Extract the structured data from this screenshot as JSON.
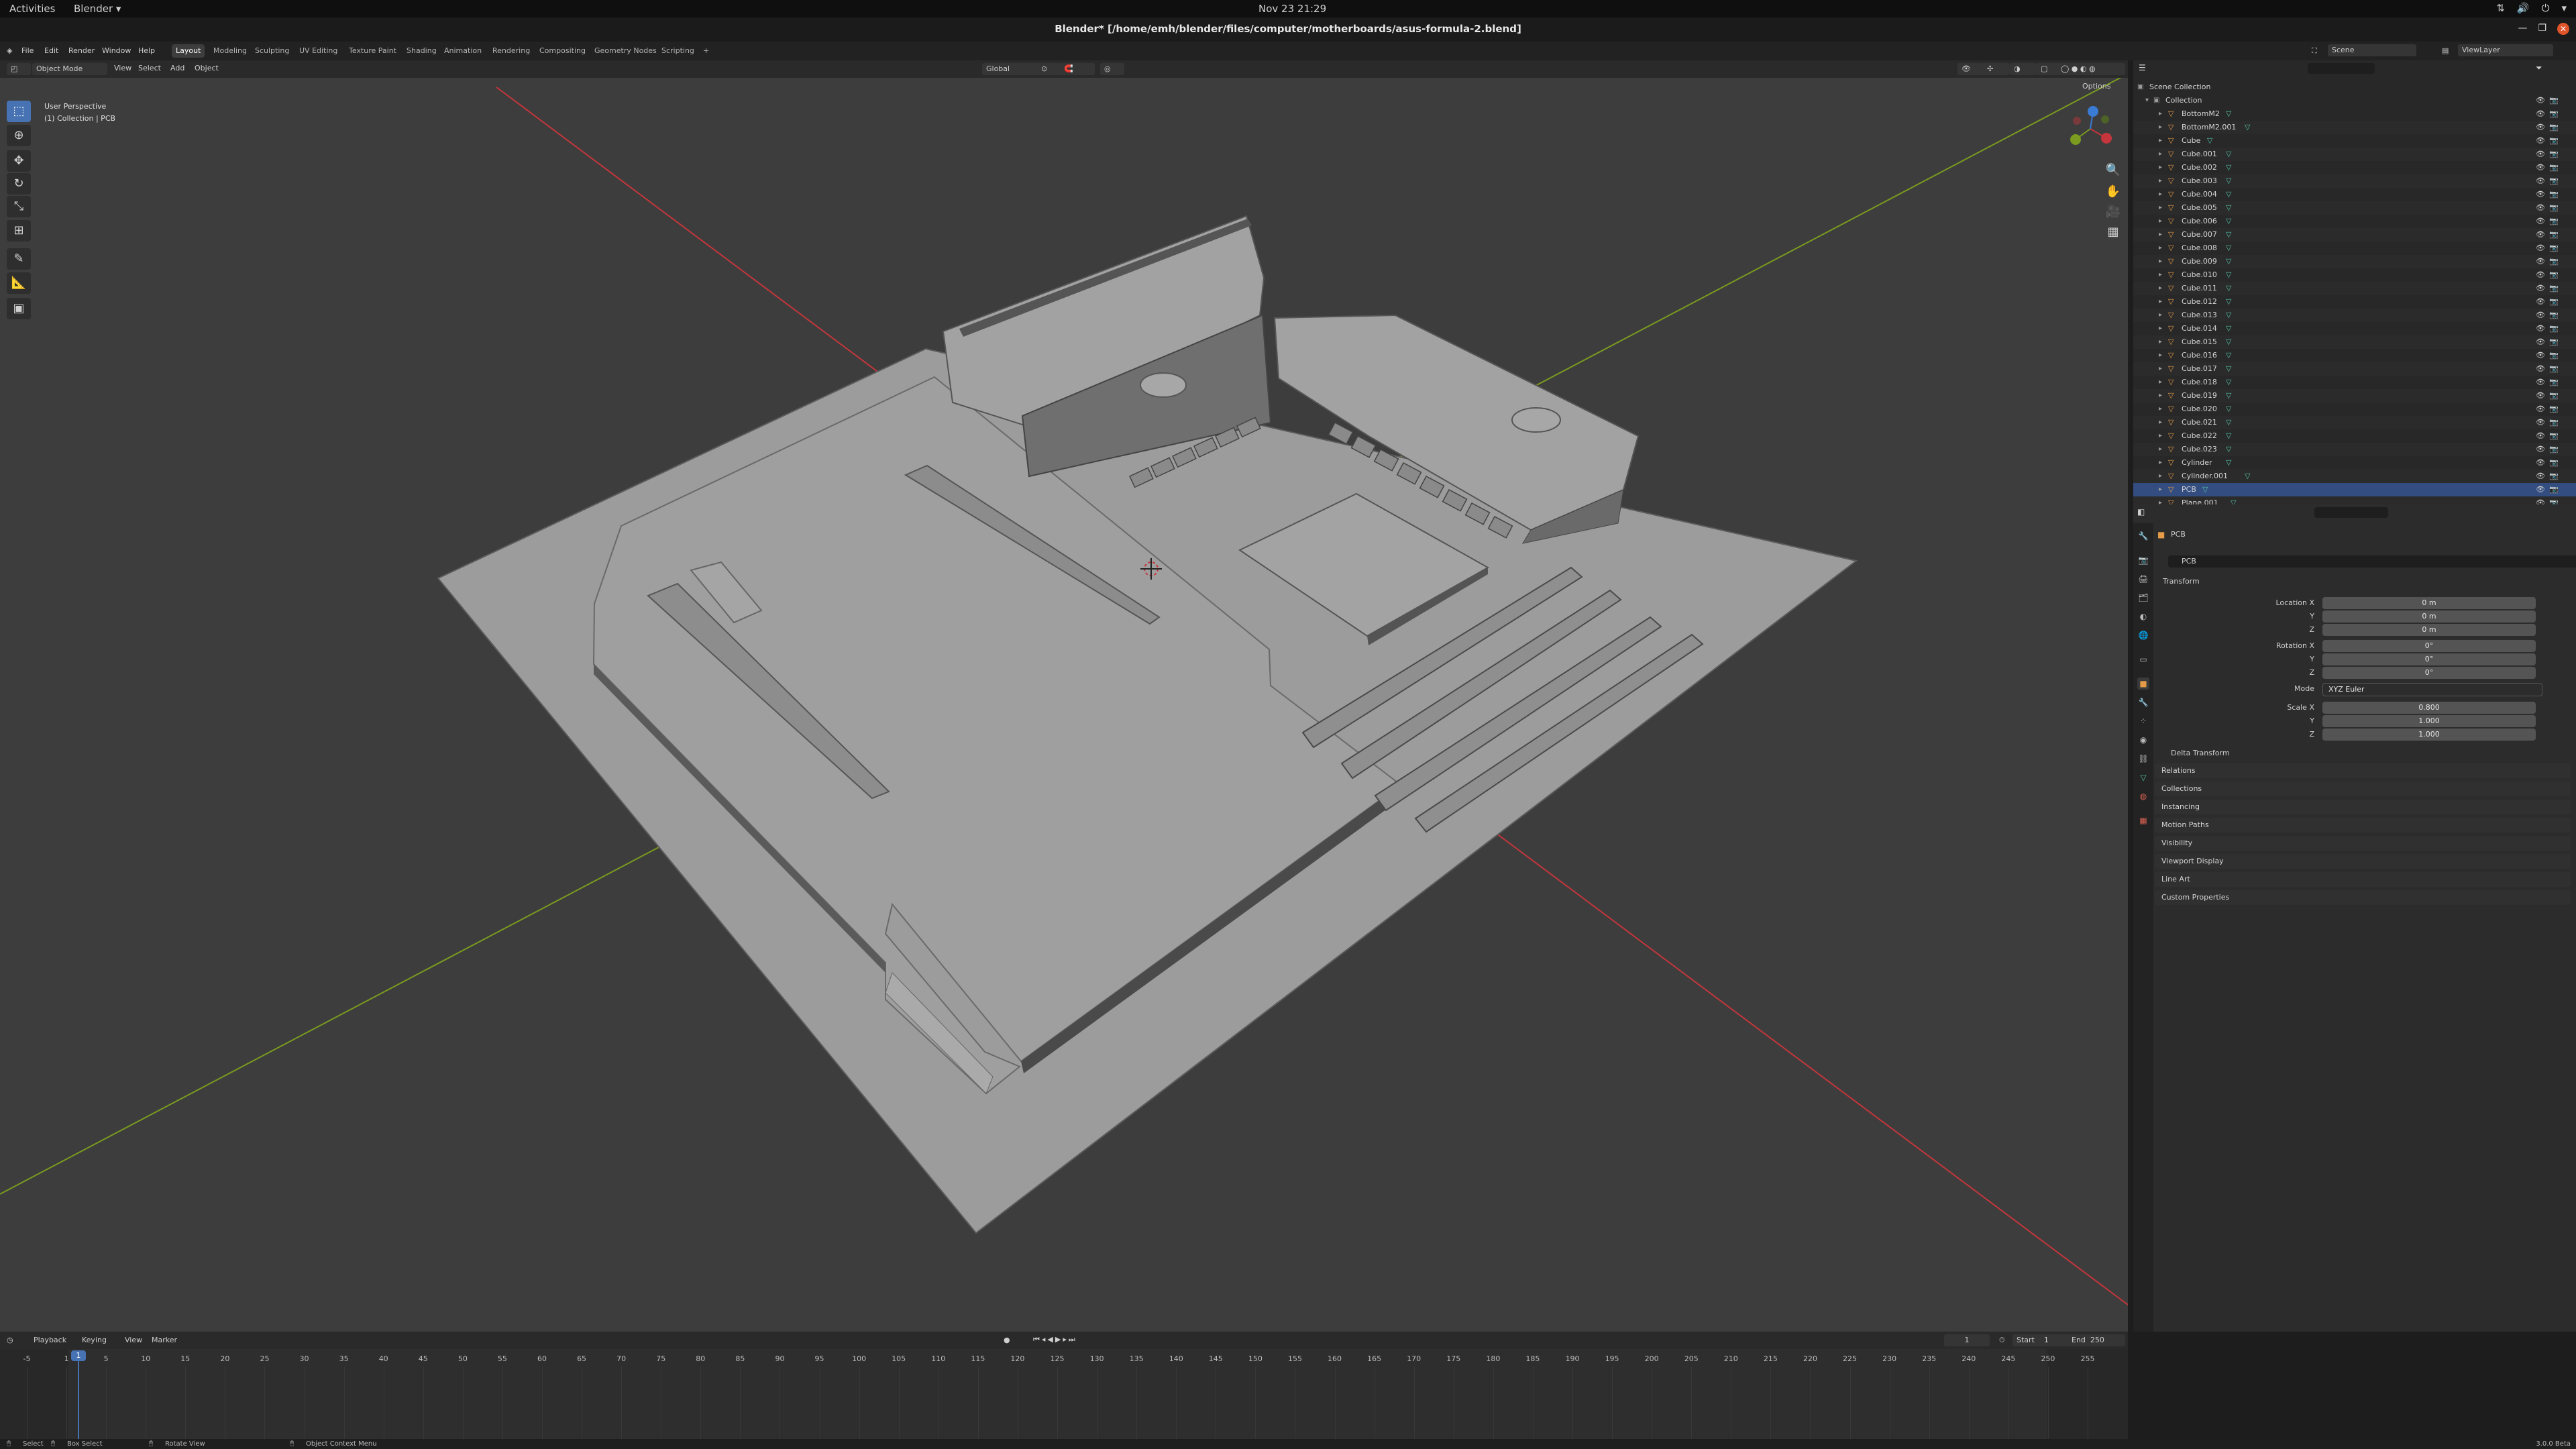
{
  "gnome": {
    "activities": "Activities",
    "app_menu": "Blender ▾",
    "clock": "Nov 23  21:29"
  },
  "window": {
    "title": "Blender* [/home/emh/blender/files/computer/motherboards/asus-formula-2.blend]"
  },
  "menus": [
    "File",
    "Edit",
    "Render",
    "Window",
    "Help"
  ],
  "workspaces": [
    "Layout",
    "Modeling",
    "Sculpting",
    "UV Editing",
    "Texture Paint",
    "Shading",
    "Animation",
    "Rendering",
    "Compositing",
    "Geometry Nodes",
    "Scripting",
    "+"
  ],
  "active_workspace": "Layout",
  "scene": {
    "scene_name": "Scene",
    "view_layer": "ViewLayer"
  },
  "viewport": {
    "mode": "Object Mode",
    "menus": [
      "View",
      "Select",
      "Add",
      "Object"
    ],
    "transform_orientation": "Global",
    "options_label": "Options",
    "perspective_label": "User Perspective",
    "collection_label": "(1) Collection | PCB"
  },
  "outliner": {
    "root": "Scene Collection",
    "collection": "Collection",
    "items": [
      "BottomM2",
      "BottomM2.001",
      "Cube",
      "Cube.001",
      "Cube.002",
      "Cube.003",
      "Cube.004",
      "Cube.005",
      "Cube.006",
      "Cube.007",
      "Cube.008",
      "Cube.009",
      "Cube.010",
      "Cube.011",
      "Cube.012",
      "Cube.013",
      "Cube.014",
      "Cube.015",
      "Cube.016",
      "Cube.017",
      "Cube.018",
      "Cube.019",
      "Cube.020",
      "Cube.021",
      "Cube.022",
      "Cube.023",
      "Cylinder",
      "Cylinder.001",
      "PCB",
      "Plane.001"
    ]
  },
  "properties": {
    "object_name": "PCB",
    "data_name": "PCB",
    "transform_label": "Transform",
    "location_label": "Location X",
    "rotation_label": "Rotation X",
    "scale_label": "Scale X",
    "mode_label": "Mode",
    "y_label": "Y",
    "z_label": "Z",
    "location": [
      "0 m",
      "0 m",
      "0 m"
    ],
    "rotation": [
      "0°",
      "0°",
      "0°"
    ],
    "mode": "XYZ Euler",
    "scale": [
      "0.800",
      "1.000",
      "1.000"
    ],
    "delta_transform": "Delta Transform",
    "panels": [
      "Relations",
      "Collections",
      "Instancing",
      "Motion Paths",
      "Visibility",
      "Viewport Display",
      "Line Art",
      "Custom Properties"
    ]
  },
  "timeline": {
    "menus": [
      "Playback",
      "Keying",
      "View",
      "Marker"
    ],
    "current_frame": "1",
    "start_label": "Start",
    "start": "1",
    "end_label": "End",
    "end": "250",
    "ticks": [
      "-5",
      "1",
      "5",
      "10",
      "15",
      "20",
      "25",
      "30",
      "35",
      "40",
      "45",
      "50",
      "55",
      "60",
      "65",
      "70",
      "75",
      "80",
      "85",
      "90",
      "95",
      "100",
      "105",
      "110",
      "115",
      "120",
      "125",
      "130",
      "135",
      "140",
      "145",
      "150",
      "155",
      "160",
      "165",
      "170",
      "175",
      "180",
      "185",
      "190",
      "195",
      "200",
      "205",
      "210",
      "215",
      "220",
      "225",
      "230",
      "235",
      "240",
      "245",
      "250",
      "255"
    ]
  },
  "status": {
    "select": "Select",
    "box_select": "Box Select",
    "rotate_view": "Rotate View",
    "context_menu": "Object Context Menu",
    "version": "3.0.0 Beta"
  },
  "colors": {
    "accent": "#4772b3",
    "x_axis": "#c4363b",
    "y_axis": "#7a9b1f",
    "object": "#e59b48",
    "mesh": "#52c2a6",
    "mesh_fill": "#9d9d9d"
  }
}
